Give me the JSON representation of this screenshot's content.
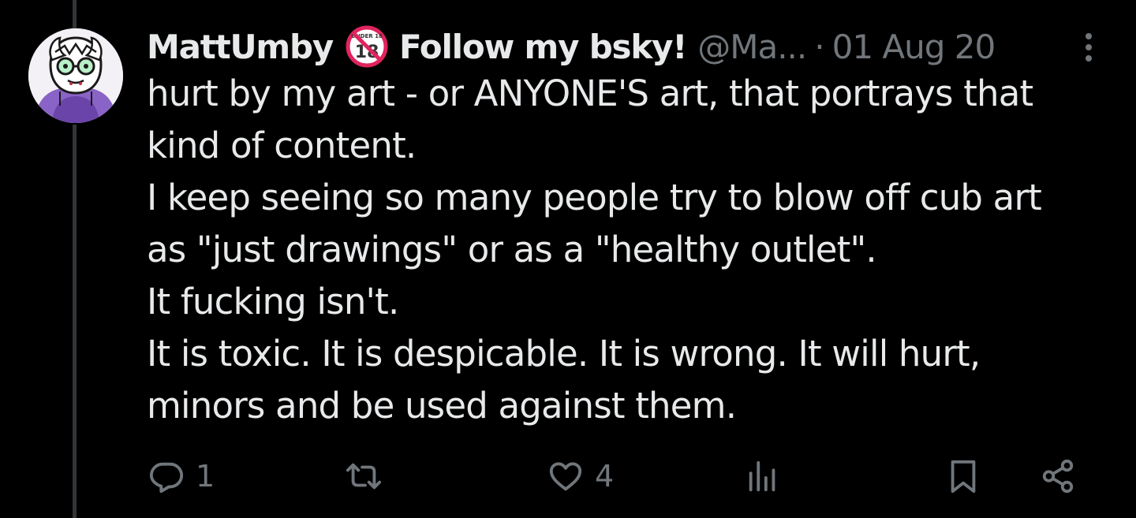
{
  "tweet": {
    "display_name": "MattUmby",
    "name_suffix": "Follow my bsky!",
    "badge_label": "UNDER 18",
    "badge_icon": "no-under-18-icon",
    "handle": "@Ma...",
    "separator": "·",
    "timestamp": "01 Aug 20",
    "text_lines": [
      "hurt by my art - or ANYONE'S art, that portrays that",
      "kind of content.",
      "I keep seeing so many people try to blow off cub art",
      "as \"just drawings\" or as a \"healthy outlet\".",
      "It fucking isn't.",
      "It is toxic. It is despicable. It is wrong. It will hurt,",
      "minors and be used against them."
    ]
  },
  "actions": {
    "reply_count": "1",
    "retweet_count": "",
    "like_count": "4",
    "views_count": ""
  },
  "colors": {
    "background": "#000000",
    "text_primary": "#e7e9ea",
    "text_secondary": "#71767b",
    "thread_line": "#333639",
    "badge_red": "#e0245e"
  }
}
